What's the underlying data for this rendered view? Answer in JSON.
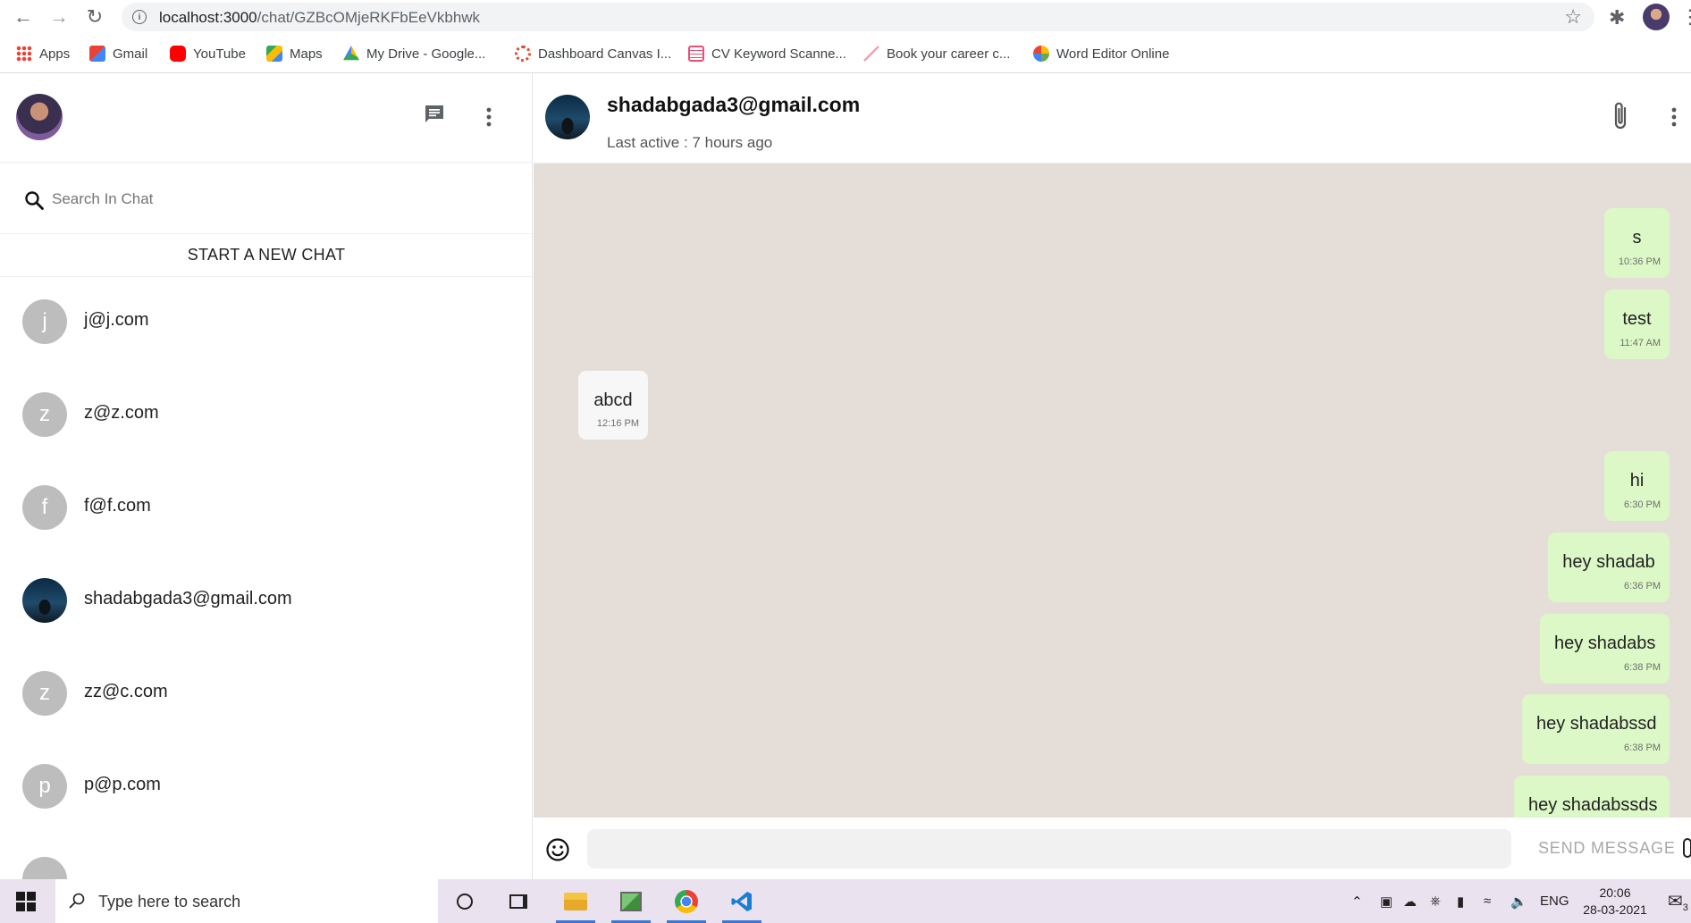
{
  "browser": {
    "url_host": "localhost:3000",
    "url_path": "/chat/GZBcOMjeRKFbEeVkbhwk",
    "bookmarks": [
      {
        "label": "Apps",
        "color": "#4285f4"
      },
      {
        "label": "Gmail",
        "color": "#ea4335"
      },
      {
        "label": "YouTube",
        "color": "#ff0000"
      },
      {
        "label": "Maps",
        "color": "#34a853"
      },
      {
        "label": "My Drive - Google...",
        "color": "#fbbc04"
      },
      {
        "label": "Dashboard Canvas I...",
        "color": "#e34a2f"
      },
      {
        "label": "CV Keyword Scanne...",
        "color": "#e94e77"
      },
      {
        "label": "Book your career c...",
        "color": "#f29fb4"
      },
      {
        "label": "Word Editor Online",
        "color": "#6aa84f"
      }
    ]
  },
  "sidebar": {
    "search_placeholder": "Search In Chat",
    "new_chat_label": "START A NEW CHAT",
    "contacts": [
      {
        "initial": "j",
        "name": "j@j.com"
      },
      {
        "initial": "z",
        "name": "z@z.com"
      },
      {
        "initial": "f",
        "name": "f@f.com"
      },
      {
        "initial": "",
        "name": "shadabgada3@gmail.com"
      },
      {
        "initial": "z",
        "name": "zz@c.com"
      },
      {
        "initial": "p",
        "name": "p@p.com"
      }
    ]
  },
  "chat": {
    "peer_name": "shadabgada3@gmail.com",
    "peer_status": "Last active : 7 hours ago",
    "messages": [
      {
        "text": "s",
        "time": "10:36 PM",
        "direction": "sent"
      },
      {
        "text": "test",
        "time": "11:47 AM",
        "direction": "sent"
      },
      {
        "text": "abcd",
        "time": "12:16 PM",
        "direction": "received"
      },
      {
        "text": "hi",
        "time": "6:30 PM",
        "direction": "sent"
      },
      {
        "text": "hey shadab",
        "time": "6:36 PM",
        "direction": "sent"
      },
      {
        "text": "hey shadabs",
        "time": "6:38 PM",
        "direction": "sent"
      },
      {
        "text": "hey shadabssd",
        "time": "6:38 PM",
        "direction": "sent"
      },
      {
        "text": "hey shadabssds",
        "time": "",
        "direction": "sent"
      }
    ],
    "input_placeholder": "",
    "send_label": "SEND MESSAGE"
  },
  "taskbar": {
    "search_placeholder": "Type here to search",
    "language": "ENG",
    "time": "20:06",
    "date": "28-03-2021",
    "notification_count": "3"
  },
  "colors": {
    "chat_background": "#e5ded8",
    "sent_bubble": "#dcf8c6",
    "received_bubble": "#f7f7f7",
    "avatar_placeholder": "#bdbdbd"
  }
}
